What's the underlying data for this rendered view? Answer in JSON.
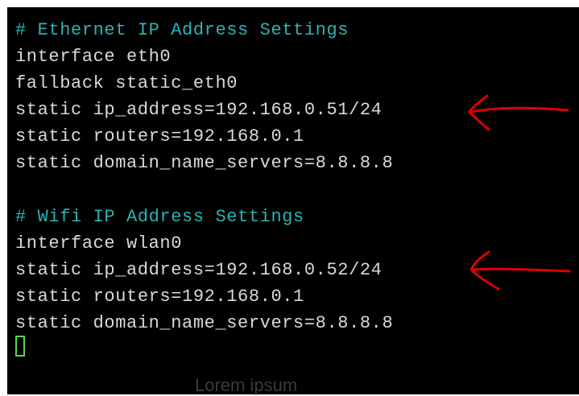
{
  "terminal": {
    "lines": [
      {
        "text": "# Ethernet IP Address Settings",
        "kind": "comment"
      },
      {
        "text": "interface eth0",
        "kind": "text"
      },
      {
        "text": "fallback static_eth0",
        "kind": "text"
      },
      {
        "text": "static ip_address=192.168.0.51/24",
        "kind": "text"
      },
      {
        "text": "static routers=192.168.0.1",
        "kind": "text"
      },
      {
        "text": "static domain_name_servers=8.8.8.8",
        "kind": "text"
      },
      {
        "text": "",
        "kind": "blank"
      },
      {
        "text": "# Wifi IP Address Settings",
        "kind": "comment"
      },
      {
        "text": "interface wlan0",
        "kind": "text"
      },
      {
        "text": "static ip_address=192.168.0.52/24",
        "kind": "text"
      },
      {
        "text": "static routers=192.168.0.1",
        "kind": "text"
      },
      {
        "text": "static domain_name_servers=8.8.8.8",
        "kind": "text"
      }
    ],
    "cursor": "block-outline"
  },
  "annotations": [
    {
      "type": "arrow",
      "points_to": "line-3",
      "color": "#e00000"
    },
    {
      "type": "arrow",
      "points_to": "line-9",
      "color": "#e00000"
    }
  ],
  "footer": {
    "text": "Lorem ipsum"
  },
  "colors": {
    "background": "#000000",
    "text": "#d9d9d9",
    "comment": "#2ab3b3",
    "cursor": "#55d35b",
    "annotation": "#e00000"
  }
}
